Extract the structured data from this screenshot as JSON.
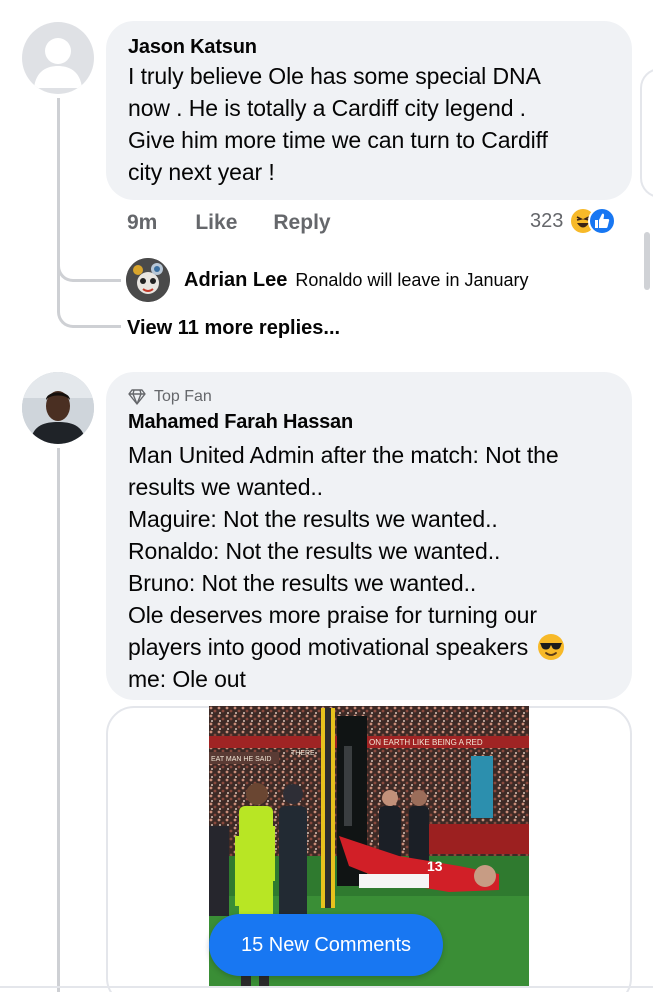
{
  "comments": [
    {
      "author": "Jason Katsun",
      "text_lines": [
        "I truly believe Ole has some special DNA",
        "now . He is totally a Cardiff city legend .",
        "Give him more time we can turn to Cardiff",
        "city next year !"
      ],
      "time": "9m",
      "like_label": "Like",
      "reply_label": "Reply",
      "reaction_count": "323",
      "reactions": [
        "haha-icon",
        "like-icon"
      ],
      "replies": [
        {
          "author": "Adrian Lee",
          "text": "Ronaldo will leave in January"
        }
      ],
      "view_more_label": "View 11 more replies..."
    },
    {
      "badge_label": "Top Fan",
      "author": "Mahamed Farah Hassan",
      "text_lines": [
        "Man United Admin after the match: Not the",
        "results we wanted..",
        "Maguire: Not the results we wanted..",
        "Ronaldo: Not the results we wanted..",
        "Bruno: Not the results we wanted..",
        "Ole deserves more praise for turning our",
        "players into good motivational speakers",
        "me: Ole out"
      ],
      "emoji": "sunglasses-emoji",
      "attachment": {
        "banner_top": "ON EARTH LIKE BEING A RED",
        "banner_left": "EAT MAN HE SAID",
        "banner_mid": "THERE",
        "shirt_number": "13"
      }
    }
  ],
  "new_comments_label": "15 New Comments",
  "colors": {
    "bubble": "#f0f2f5",
    "meta": "#65676b",
    "accent": "#1877f2",
    "thread": "#ced0d4"
  }
}
